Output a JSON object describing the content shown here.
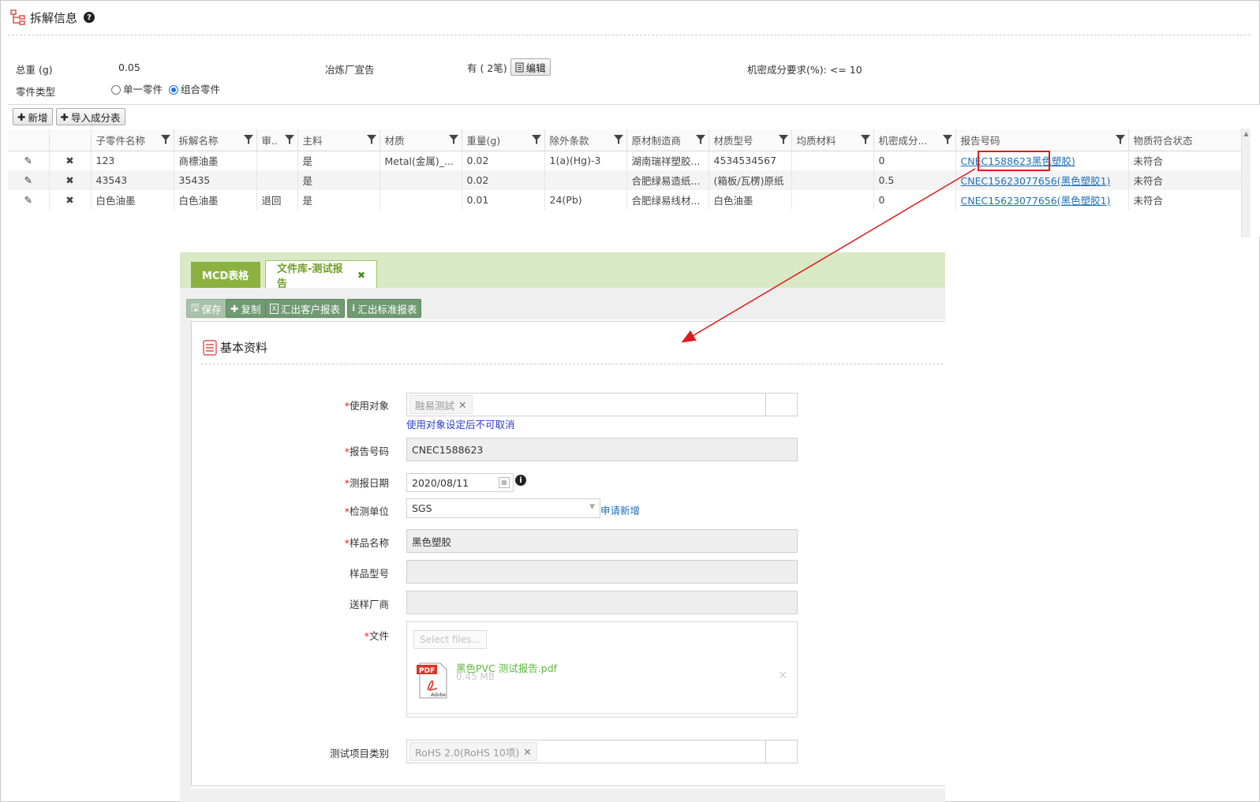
{
  "header": {
    "title": "拆解信息"
  },
  "summary": {
    "total_weight_label": "总重 (g)",
    "total_weight_value": "0.05",
    "smelter_label": "冶炼厂宣告",
    "smelter_value": "有 ( 2笔)",
    "edit_label": "编辑",
    "secret_label": "机密成分要求(%):",
    "secret_value": "<= 10",
    "part_type_label": "零件类型",
    "part_type_opt1": "单一零件",
    "part_type_opt2": "组合零件",
    "part_type_selected": "组合零件"
  },
  "grid_toolbar": {
    "add_label": "新增",
    "import_label": "导入成分表"
  },
  "grid": {
    "columns": [
      "子零件名称",
      "拆解名称",
      "审..",
      "主料",
      "材质",
      "重量(g)",
      "除外条款",
      "原材制造商",
      "材质型号",
      "均质材料",
      "机密成分...",
      "报告号码",
      "物质符合状态"
    ],
    "rows": [
      {
        "child": "123",
        "split": "商標油墨",
        "review": "",
        "main": "是",
        "material": "Metal(金属)_...",
        "weight": "0.02",
        "exempt": "1(a)(Hg)-3",
        "maker": "湖南瑞祥塑胶...",
        "model": "4534534567",
        "homo": "",
        "secret": "0",
        "report_a": "CNEC1588623",
        "report_b": "黑色塑胶)",
        "status": "未符合"
      },
      {
        "child": "43543",
        "split": "35435",
        "review": "",
        "main": "是",
        "material": "",
        "weight": "0.02",
        "exempt": "",
        "maker": "合肥绿易造纸...",
        "model": "(箱板/瓦楞)原纸",
        "homo": "",
        "secret": "0.5",
        "report_a": "CNEC15623077656(黑色塑胶1)",
        "report_b": "",
        "status": "未符合"
      },
      {
        "child": "白色油墨",
        "split": "白色油墨",
        "review": "退回",
        "main": "是",
        "material": "",
        "weight": "0.01",
        "exempt": "24(Pb)",
        "maker": "合肥绿易线材...",
        "model": "白色油墨",
        "homo": "",
        "secret": "0",
        "report_a": "CNEC15623077656(黑色塑胶1)",
        "report_b": "",
        "status": "未符合"
      }
    ]
  },
  "tabs": {
    "mcd": "MCD表格",
    "lib": "文件库-测试报告"
  },
  "toolbar": {
    "save": "保存",
    "copy": "复制",
    "export_customer": "汇出客户报表",
    "export_standard": "汇出标准报表"
  },
  "form": {
    "section_title": "基本资料",
    "target_label": "使用对象",
    "target_chip": "融易测試",
    "target_hint": "使用对象设定后不可取消",
    "report_no_label": "报告号码",
    "report_no_value": "CNEC1588623",
    "date_label": "测报日期",
    "date_value": "2020/08/11",
    "lab_label": "检测单位",
    "lab_value": "SGS",
    "lab_apply": "申请新增",
    "sample_name_label": "样品名称",
    "sample_name_value": "黑色塑胶",
    "sample_model_label": "样品型号",
    "sample_model_value": "",
    "vendor_label": "送样厂商",
    "vendor_value": "",
    "file_label": "文件",
    "select_files": "Select files...",
    "file_name": "黑色PVC  测试报告.pdf",
    "file_size": "0.45 MB",
    "test_category_label": "测试项目类别",
    "test_category_chip": "RoHS 2.0(RoHS 10项)"
  },
  "colors": {
    "tab_green": "#8bb23e",
    "tab_bar": "#d9e9c6",
    "btn_green": "#6f9a72",
    "link_blue": "#1f6fb8",
    "arrow_red": "#e01a1a"
  }
}
